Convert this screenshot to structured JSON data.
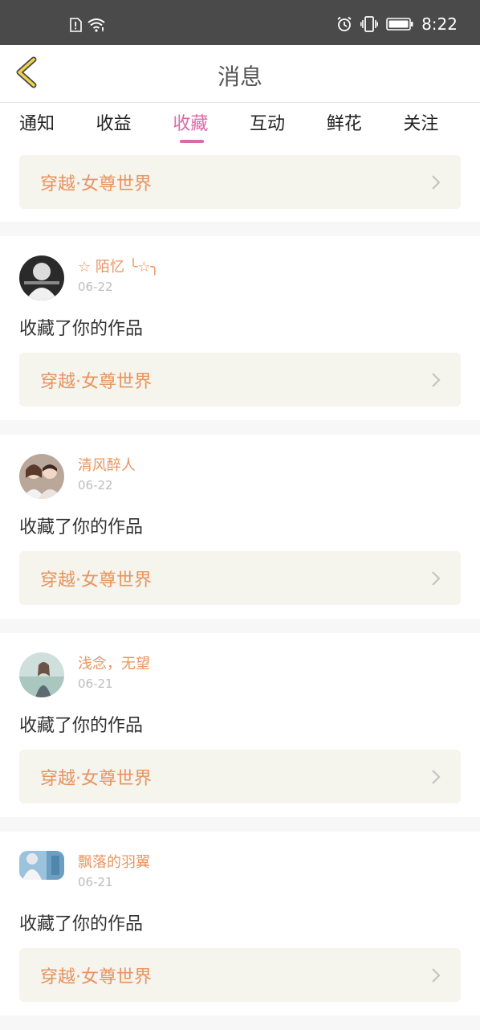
{
  "status_bar": {
    "time": "8:22",
    "icons": [
      "sim-alert-icon",
      "wifi-icon",
      "alarm-icon",
      "vibrate-icon",
      "battery-icon"
    ]
  },
  "header": {
    "title": "消息",
    "back_icon": "chevron-left-icon"
  },
  "tabs": [
    {
      "label": "通知",
      "active": false
    },
    {
      "label": "收益",
      "active": false
    },
    {
      "label": "收藏",
      "active": true
    },
    {
      "label": "互动",
      "active": false
    },
    {
      "label": "鲜花",
      "active": false
    },
    {
      "label": "关注",
      "active": false
    }
  ],
  "colors": {
    "accent": "#d96aa8",
    "name_orange": "#e8945f",
    "link_bg": "#f5f4ed"
  },
  "first_card": {
    "work_title": "穿越·女尊世界"
  },
  "messages": [
    {
      "username": "☆ 陌忆 ╰☆╮",
      "date": "06-22",
      "action": "收藏了你的作品",
      "work_title": "穿越·女尊世界"
    },
    {
      "username": "清风醉人",
      "date": "06-22",
      "action": "收藏了你的作品",
      "work_title": "穿越·女尊世界"
    },
    {
      "username": "浅念，无望",
      "date": "06-21",
      "action": "收藏了你的作品",
      "work_title": "穿越·女尊世界"
    },
    {
      "username": "飘落的羽翼",
      "date": "06-21",
      "action": "收藏了你的作品",
      "work_title": "穿越·女尊世界"
    }
  ]
}
